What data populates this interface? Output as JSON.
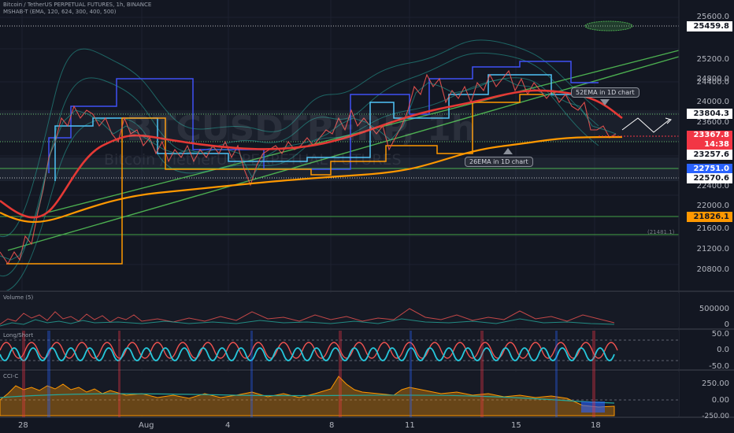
{
  "header": {
    "symbol_line": "Bitcoin / TetherUS PERPETUAL FUTURES, 1h, BINANCE",
    "indicator_line": "MSHAB-T (EMA, 120, 624, 300, 400, 500)"
  },
  "watermark": {
    "ticker": "BTCUSDTPERP, 1h",
    "description": "Bitcoin / TetherUS PERPETUAL FUTURES"
  },
  "price_axis": {
    "ticks": [
      "25600.0",
      "25200.0",
      "24800.0",
      "24400.0",
      "24000.0",
      "23600.0",
      "22400.0",
      "22000.0",
      "21600.0",
      "21200.0",
      "20800.0"
    ]
  },
  "badges": {
    "level_top": "25459.8",
    "level_2": "23804.3",
    "current_price": "23367.8",
    "countdown": "14:38",
    "level_3": "23257.6",
    "level_4": "22751.0",
    "level_5": "22570.6",
    "level_6": "21826.1"
  },
  "level_note": "(21481.1)",
  "annotations": {
    "ema52": "52EMA in 1D chart",
    "ema26": "26EMA in 1D chart"
  },
  "volume_pane": {
    "title": "Volume (5)",
    "ticks": [
      "500000",
      "0"
    ]
  },
  "longshort_pane": {
    "title": "Long/Short",
    "ticks": [
      "50.0",
      "0.0",
      "-50.0"
    ]
  },
  "oscillator_pane": {
    "title": "CCI-C",
    "ticks": [
      "250.00",
      "0.00",
      "-250.00"
    ]
  },
  "time_axis": {
    "labels": [
      "28",
      "Aug",
      "4",
      "8",
      "11",
      "15",
      "18"
    ]
  },
  "colors": {
    "background": "#131722",
    "red_ema": "#e53935",
    "orange_ema": "#ff9800",
    "green_trend": "#4caf50",
    "blue_box": "#3f51f5",
    "cyan_box": "#4fc3f7",
    "current_price_badge": "#f23645",
    "orange_badge": "#ff9800",
    "blue_badge": "#2962ff"
  }
}
